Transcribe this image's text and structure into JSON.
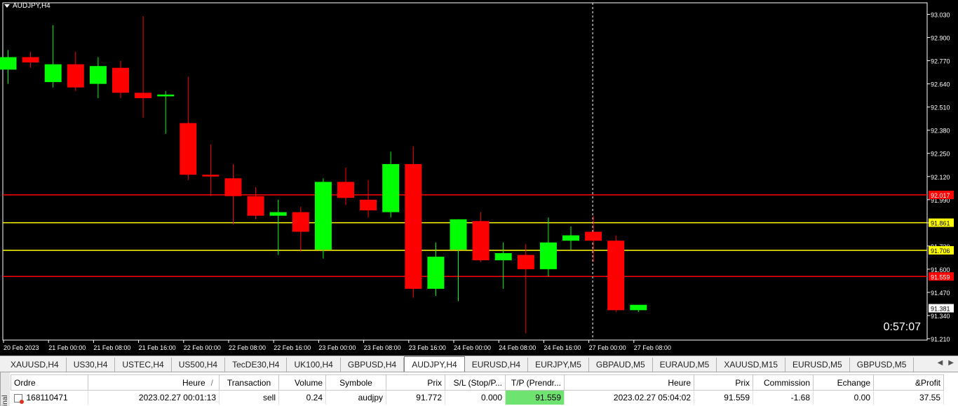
{
  "chart": {
    "title": "AUDJPY,H4",
    "countdown": "0:57:07",
    "colors": {
      "bull": "#00ff00",
      "bear": "#ff0000",
      "wick_bull": "#00ff00",
      "wick_bear": "#ff0000",
      "grid": "#000000",
      "axis_text": "#ffffff",
      "red_line": "#ff0000",
      "yellow_line": "#ffff00"
    },
    "price_axis": [
      "93.030",
      "92.900",
      "92.770",
      "92.640",
      "92.510",
      "92.380",
      "92.250",
      "92.120",
      "91.990",
      "91.860",
      "91.730",
      "91.600",
      "91.470",
      "91.340",
      "91.210"
    ],
    "price_range": [
      91.21,
      93.03
    ],
    "time_labels": [
      "20 Feb 2023",
      "21 Feb 00:00",
      "21 Feb 08:00",
      "21 Feb 16:00",
      "22 Feb 00:00",
      "22 Feb 08:00",
      "22 Feb 16:00",
      "23 Feb 00:00",
      "23 Feb 08:00",
      "23 Feb 16:00",
      "24 Feb 00:00",
      "24 Feb 08:00",
      "24 Feb 16:00",
      "27 Feb 00:00",
      "27 Feb 08:00"
    ],
    "levels": [
      {
        "price": 92.017,
        "label": "92.017",
        "color": "#ff0000"
      },
      {
        "price": 91.861,
        "label": "91.861",
        "color": "#ffff00"
      },
      {
        "price": 91.706,
        "label": "91.706",
        "color": "#ffff00"
      },
      {
        "price": 91.559,
        "label": "91.559",
        "color": "#ff0000"
      }
    ],
    "current_price": {
      "price": 91.381,
      "label": "91.381"
    },
    "crosshair_index": 26,
    "candles": [
      {
        "o": 92.72,
        "h": 92.83,
        "l": 92.64,
        "c": 92.79
      },
      {
        "o": 92.79,
        "h": 92.82,
        "l": 92.73,
        "c": 92.76
      },
      {
        "o": 92.65,
        "h": 92.97,
        "l": 92.62,
        "c": 92.75
      },
      {
        "o": 92.75,
        "h": 92.82,
        "l": 92.6,
        "c": 92.62
      },
      {
        "o": 92.64,
        "h": 92.79,
        "l": 92.56,
        "c": 92.74
      },
      {
        "o": 92.73,
        "h": 92.77,
        "l": 92.56,
        "c": 92.59
      },
      {
        "o": 92.59,
        "h": 93.02,
        "l": 92.45,
        "c": 92.56
      },
      {
        "o": 92.57,
        "h": 92.6,
        "l": 92.36,
        "c": 92.58
      },
      {
        "o": 92.42,
        "h": 92.68,
        "l": 92.1,
        "c": 92.13
      },
      {
        "o": 92.13,
        "h": 92.3,
        "l": 92.01,
        "c": 92.12
      },
      {
        "o": 92.11,
        "h": 92.19,
        "l": 91.85,
        "c": 92.01
      },
      {
        "o": 92.01,
        "h": 92.06,
        "l": 91.88,
        "c": 91.9
      },
      {
        "o": 91.9,
        "h": 91.99,
        "l": 91.68,
        "c": 91.92
      },
      {
        "o": 91.92,
        "h": 91.95,
        "l": 91.7,
        "c": 91.81
      },
      {
        "o": 91.71,
        "h": 92.11,
        "l": 91.66,
        "c": 92.09
      },
      {
        "o": 92.09,
        "h": 92.17,
        "l": 91.96,
        "c": 92.0
      },
      {
        "o": 91.99,
        "h": 92.1,
        "l": 91.89,
        "c": 91.93
      },
      {
        "o": 91.92,
        "h": 92.26,
        "l": 91.89,
        "c": 92.19
      },
      {
        "o": 92.19,
        "h": 92.29,
        "l": 91.44,
        "c": 91.49
      },
      {
        "o": 91.49,
        "h": 91.75,
        "l": 91.45,
        "c": 91.67
      },
      {
        "o": 91.71,
        "h": 91.88,
        "l": 91.42,
        "c": 91.88
      },
      {
        "o": 91.87,
        "h": 91.92,
        "l": 91.64,
        "c": 91.65
      },
      {
        "o": 91.65,
        "h": 91.75,
        "l": 91.49,
        "c": 91.69
      },
      {
        "o": 91.68,
        "h": 91.74,
        "l": 91.24,
        "c": 91.6
      },
      {
        "o": 91.6,
        "h": 91.89,
        "l": 91.56,
        "c": 91.75
      },
      {
        "o": 91.76,
        "h": 91.84,
        "l": 91.71,
        "c": 91.79
      },
      {
        "o": 91.81,
        "h": 91.9,
        "l": 91.64,
        "c": 91.76
      },
      {
        "o": 91.76,
        "h": 91.79,
        "l": 91.36,
        "c": 91.37
      },
      {
        "o": 91.37,
        "h": 91.4,
        "l": 91.36,
        "c": 91.4
      }
    ]
  },
  "tabs": [
    {
      "label": "XAUUSD,H4",
      "active": false
    },
    {
      "label": "US30,H4",
      "active": false
    },
    {
      "label": "USTEC,H4",
      "active": false
    },
    {
      "label": "US500,H4",
      "active": false
    },
    {
      "label": "TecDE30,H4",
      "active": false
    },
    {
      "label": "UK100,H4",
      "active": false
    },
    {
      "label": "GBPUSD,H4",
      "active": false
    },
    {
      "label": "AUDJPY,H4",
      "active": true
    },
    {
      "label": "EURUSD,H4",
      "active": false
    },
    {
      "label": "EURJPY,M5",
      "active": false
    },
    {
      "label": "GBPAUD,M5",
      "active": false
    },
    {
      "label": "EURAUD,M5",
      "active": false
    },
    {
      "label": "XAUUSD,M15",
      "active": false
    },
    {
      "label": "EURUSD,M5",
      "active": false
    },
    {
      "label": "GBPUSD,M5",
      "active": false
    }
  ],
  "terminal": {
    "side_label": "inal",
    "columns": [
      "Ordre",
      "Heure",
      "Transaction",
      "Volume",
      "Symbole",
      "Prix",
      "S/L (Stop/P...",
      "T/P (Prendr...",
      "Heure",
      "Prix",
      "Commission",
      "Echange",
      "&Profit"
    ],
    "sort_indicator": "/",
    "rows": [
      [
        "168110471",
        "2023.02.27 00:01:13",
        "sell",
        "0.24",
        "audjpy",
        "91.772",
        "0.000",
        "91.559",
        "2023.02.27 05:04:02",
        "91.559",
        "-1.68",
        "0.00",
        "37.55"
      ]
    ]
  }
}
